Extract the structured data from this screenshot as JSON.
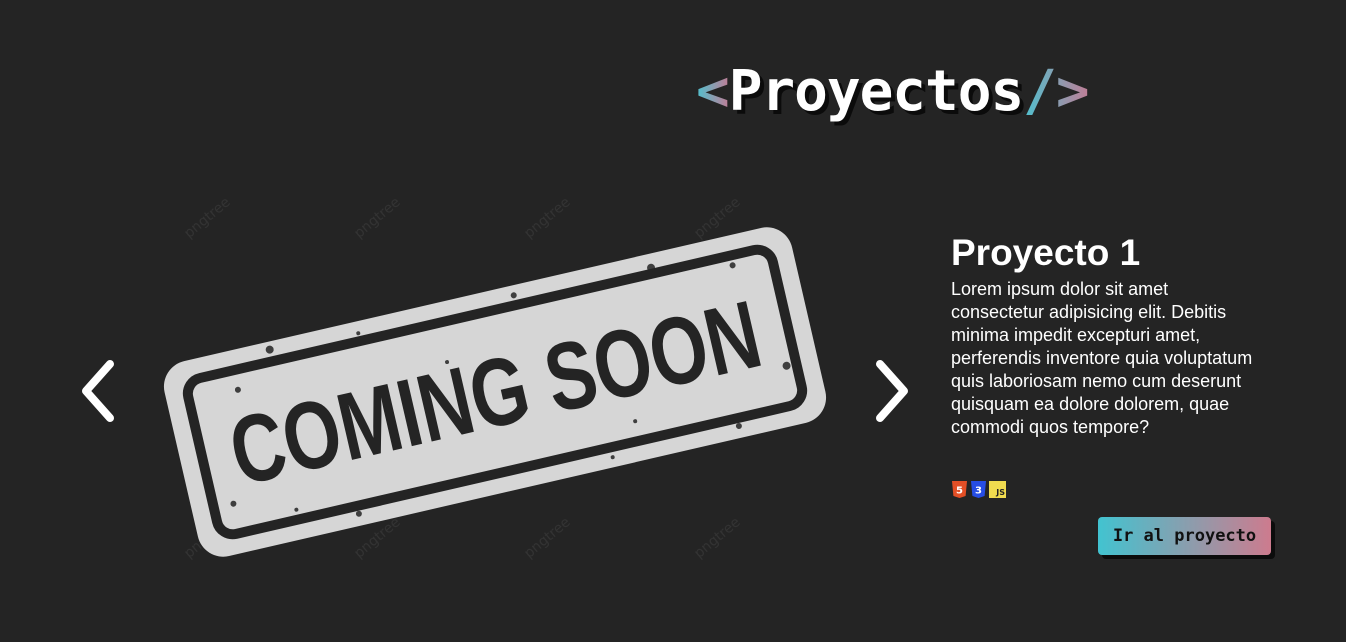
{
  "header": {
    "bracket_open": "<",
    "title": "Proyectos",
    "bracket_close": "/>"
  },
  "carousel": {
    "prev_icon": "chevron-left-icon",
    "next_icon": "chevron-right-icon",
    "image": {
      "stamp_text": "COMING SOON",
      "watermark_text": "pngtree"
    }
  },
  "project": {
    "title": "Proyecto 1",
    "description": "Lorem ipsum dolor sit amet consectetur adipisicing elit. Debitis minima impedit excepturi amet, perferendis inventore quia voluptatum quis laboriosam nemo cum deserunt quisquam ea dolore dolorem, quae commodi quos tempore?",
    "technologies": [
      {
        "name": "html5-icon",
        "label": "5",
        "color": "#e34f26"
      },
      {
        "name": "css3-icon",
        "label": "3",
        "color": "#264de4"
      },
      {
        "name": "javascript-icon",
        "label": "JS",
        "color": "#f0db4f"
      }
    ],
    "button_label": "Ir al proyecto"
  },
  "colors": {
    "background": "#242424",
    "gradient_start": "#42c3d0",
    "gradient_end": "#cd7b8e",
    "stamp": "#d6d6d6"
  }
}
